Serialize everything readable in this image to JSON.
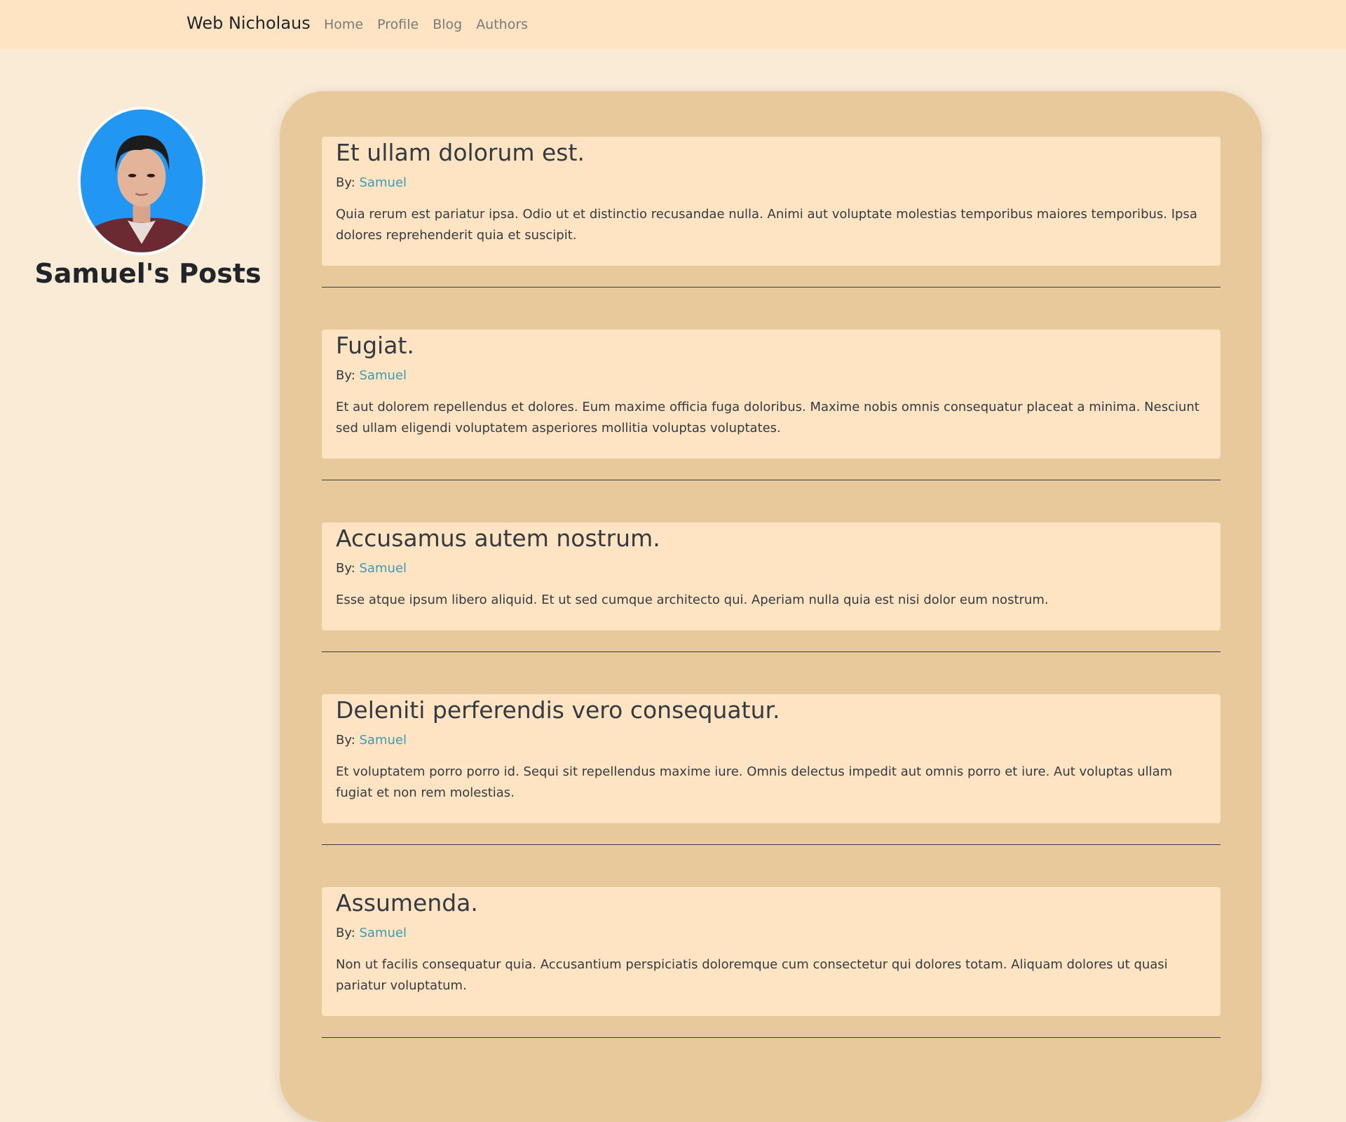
{
  "navbar": {
    "brand": "Web Nicholaus",
    "links": [
      "Home",
      "Profile",
      "Blog",
      "Authors"
    ]
  },
  "sidebar": {
    "title": "Samuel's Posts"
  },
  "posts": [
    {
      "title": "Et ullam dolorum est.",
      "by_label": "By:",
      "author": "Samuel",
      "body": "Quia rerum est pariatur ipsa. Odio ut et distinctio recusandae nulla. Animi aut voluptate molestias temporibus maiores temporibus. Ipsa dolores reprehenderit quia et suscipit."
    },
    {
      "title": "Fugiat.",
      "by_label": "By:",
      "author": "Samuel",
      "body": "Et aut dolorem repellendus et dolores. Eum maxime officia fuga doloribus. Maxime nobis omnis consequatur placeat a minima. Nesciunt sed ullam eligendi voluptatem asperiores mollitia voluptas voluptates."
    },
    {
      "title": "Accusamus autem nostrum.",
      "by_label": "By:",
      "author": "Samuel",
      "body": "Esse atque ipsum libero aliquid. Et ut sed cumque architecto qui. Aperiam nulla quia est nisi dolor eum nostrum."
    },
    {
      "title": "Deleniti perferendis vero consequatur.",
      "by_label": "By:",
      "author": "Samuel",
      "body": "Et voluptatem porro porro id. Sequi sit repellendus maxime iure. Omnis delectus impedit aut omnis porro et iure. Aut voluptas ullam fugiat et non rem molestias."
    },
    {
      "title": "Assumenda.",
      "by_label": "By:",
      "author": "Samuel",
      "body": "Non ut facilis consequatur quia. Accusantium perspiciatis doloremque cum consectetur qui dolores totam. Aliquam dolores ut quasi pariatur voluptatum."
    }
  ],
  "colors": {
    "page_bg": "#faebd7",
    "navbar_bg": "#ffe4c4",
    "panel_bg": "#e8c99b",
    "card_bg": "#ffe4c4",
    "link": "#3b9bb3",
    "avatar_bg": "#2196f3"
  }
}
